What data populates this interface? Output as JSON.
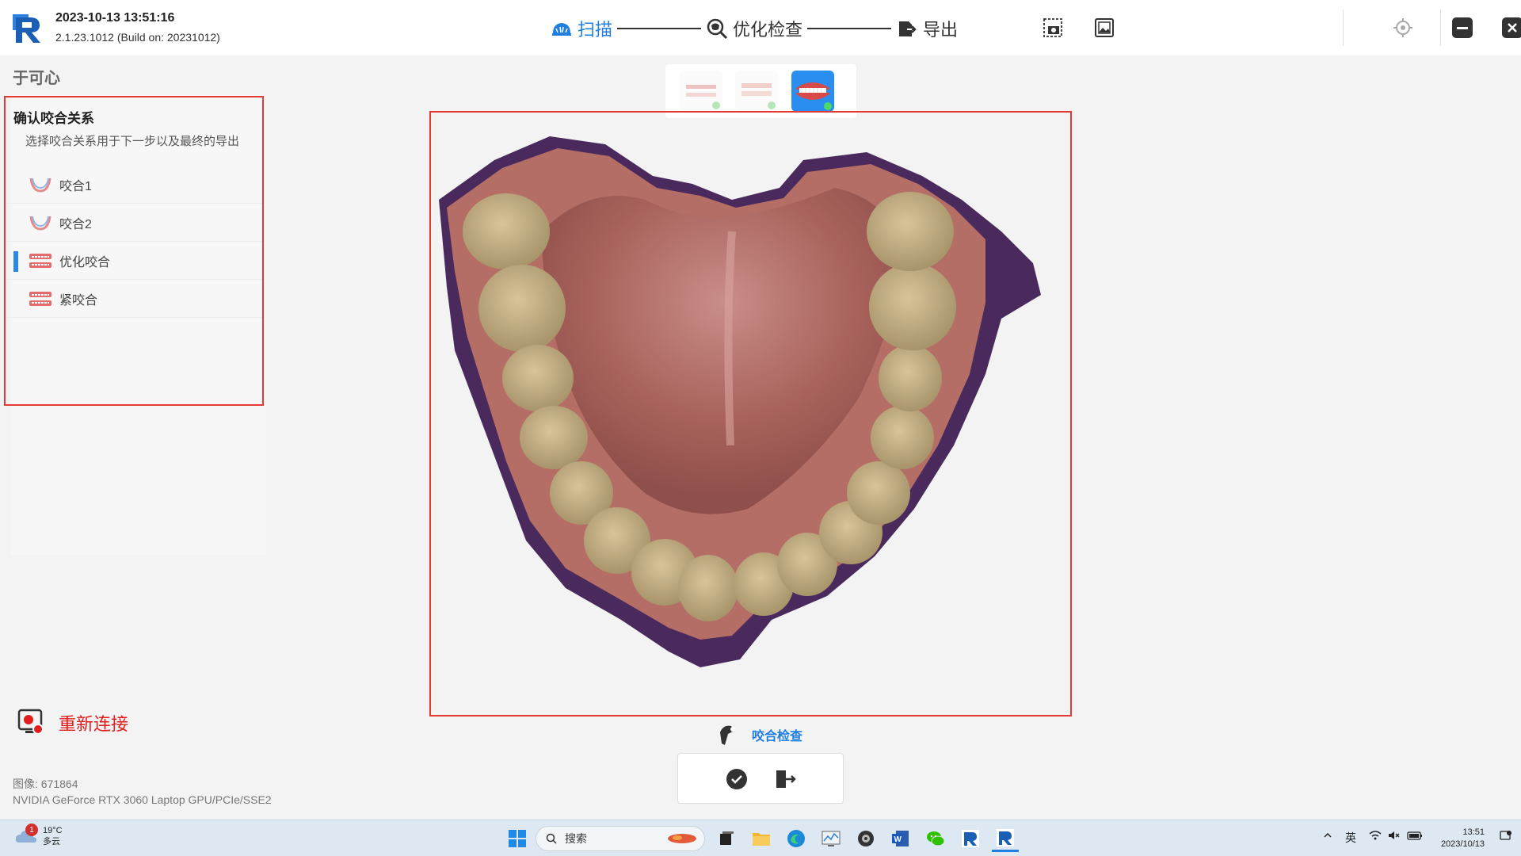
{
  "app": {
    "datetime": "2023-10-13 13:51:16",
    "version": "2.1.23.1012 (Build on: 20231012)"
  },
  "steps": [
    {
      "label": "扫描",
      "icon": "scan-teeth-icon",
      "active": true
    },
    {
      "label": "优化检查",
      "icon": "inspect-teeth-icon",
      "active": false
    },
    {
      "label": "导出",
      "icon": "export-icon",
      "active": false
    }
  ],
  "toolbar_icons": [
    "screenshot-icon",
    "image-gallery-icon",
    "locate-target-icon",
    "minimize-icon",
    "close-icon"
  ],
  "patient": {
    "name": "于可心"
  },
  "bite": {
    "title": "确认咬合关系",
    "description": "选择咬合关系用于下一步以及最终的导出",
    "items": [
      {
        "label": "咬合1",
        "active": false
      },
      {
        "label": "咬合2",
        "active": false
      },
      {
        "label": "优化咬合",
        "active": true
      },
      {
        "label": "紧咬合",
        "active": false
      }
    ]
  },
  "reconnect": {
    "label": "重新连接"
  },
  "system": {
    "image_label": "图像: 671864",
    "gpu": "NVIDIA GeForce RTX 3060 Laptop GPU/PCIe/SSE2"
  },
  "viewer": {
    "bite_check_label": "咬合检查"
  },
  "colors": {
    "accent": "#1e7fe0",
    "highlight_border": "#e53935",
    "reconnect_red": "#e01e1e"
  },
  "taskbar": {
    "weather_temp": "19°C",
    "weather_desc": "多云",
    "weather_badge": "1",
    "search_label": "搜索",
    "ime": "英",
    "time": "13:51",
    "date": "2023/10/13"
  }
}
